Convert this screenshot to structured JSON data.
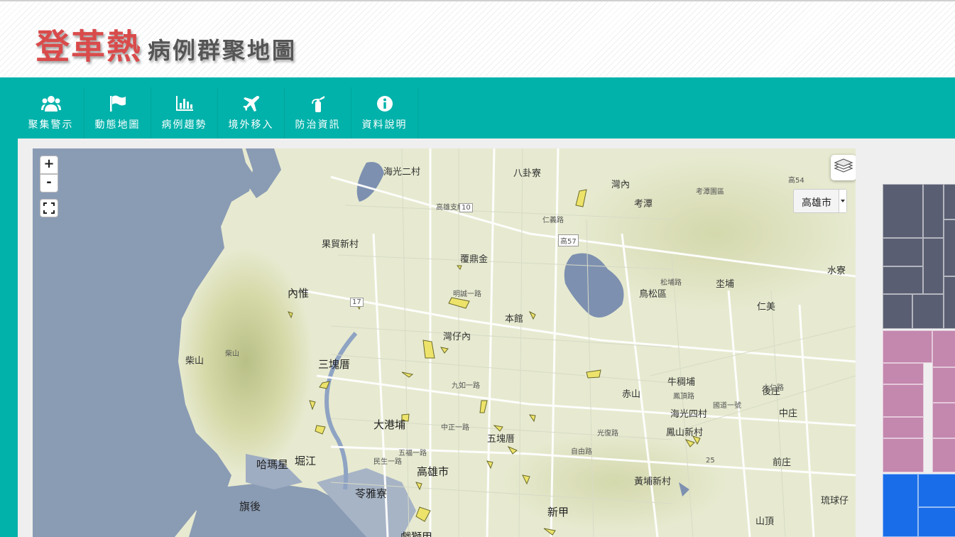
{
  "header": {
    "title_main": "登革熱",
    "title_sub": "病例群聚地圖"
  },
  "nav": {
    "items": [
      {
        "label": "聚集警示",
        "icon": "users-icon"
      },
      {
        "label": "動態地圖",
        "icon": "flag-icon"
      },
      {
        "label": "病例趨勢",
        "icon": "bar-chart-icon"
      },
      {
        "label": "境外移入",
        "icon": "plane-icon"
      },
      {
        "label": "防治資訊",
        "icon": "fire-extinguisher-icon"
      },
      {
        "label": "資料說明",
        "icon": "info-icon"
      }
    ]
  },
  "map": {
    "zoom_in": "+",
    "zoom_out": "-",
    "city_select": "高雄市",
    "labels": {
      "l1": "海光二村",
      "l2": "八卦寮",
      "l3": "灣內",
      "l4": "考潭",
      "l5": "果貿新村",
      "l6": "覆鼎金",
      "l7": "內惟",
      "l8": "本館",
      "l9": "鳥松區",
      "l10": "坔埔",
      "l11": "仁美",
      "l12": "水寮",
      "l13": "柴山",
      "l14": "柴山",
      "l15": "三塊厝",
      "l16": "灣仔內",
      "l17": "牛稠埔",
      "l18": "赤山",
      "l19": "後庄",
      "l20": "大港埔",
      "l21": "海光四村",
      "l22": "中庄",
      "l23": "鳳山新村",
      "l24": "五塊厝",
      "l25": "哈瑪星",
      "l26": "堀江",
      "l27": "高雄市",
      "l28": "前庄",
      "l29": "苓雅寮",
      "l30": "黃埔新村",
      "l31": "旗後",
      "l32": "新甲",
      "l33": "琉球仔",
      "l34": "山頂",
      "l35": "戲獅甲",
      "s1": "高雄支線",
      "s2": "仁義路",
      "s3": "明誠一路",
      "s4": "九如一路",
      "s5": "中正一路",
      "s6": "民生一路",
      "s7": "五福一路",
      "s8": "自由路",
      "s9": "光復路",
      "s10": "松埔路",
      "s11": "大仁路",
      "s12": "國道一號",
      "s13": "鳳頂路",
      "s14": "考潭園區",
      "r1": "10",
      "r2": "高57",
      "r3": "17",
      "r4": "25",
      "r5": "高54"
    }
  },
  "colors": {
    "teal": "#00b2aa",
    "title_red": "#d94b4b",
    "cluster": "#ede36a",
    "sea": "#8a9bb4"
  },
  "treemap": {
    "groups": [
      {
        "color": "#5a5e72"
      },
      {
        "color": "#c487ae"
      },
      {
        "color": "#1a6de8"
      }
    ]
  }
}
